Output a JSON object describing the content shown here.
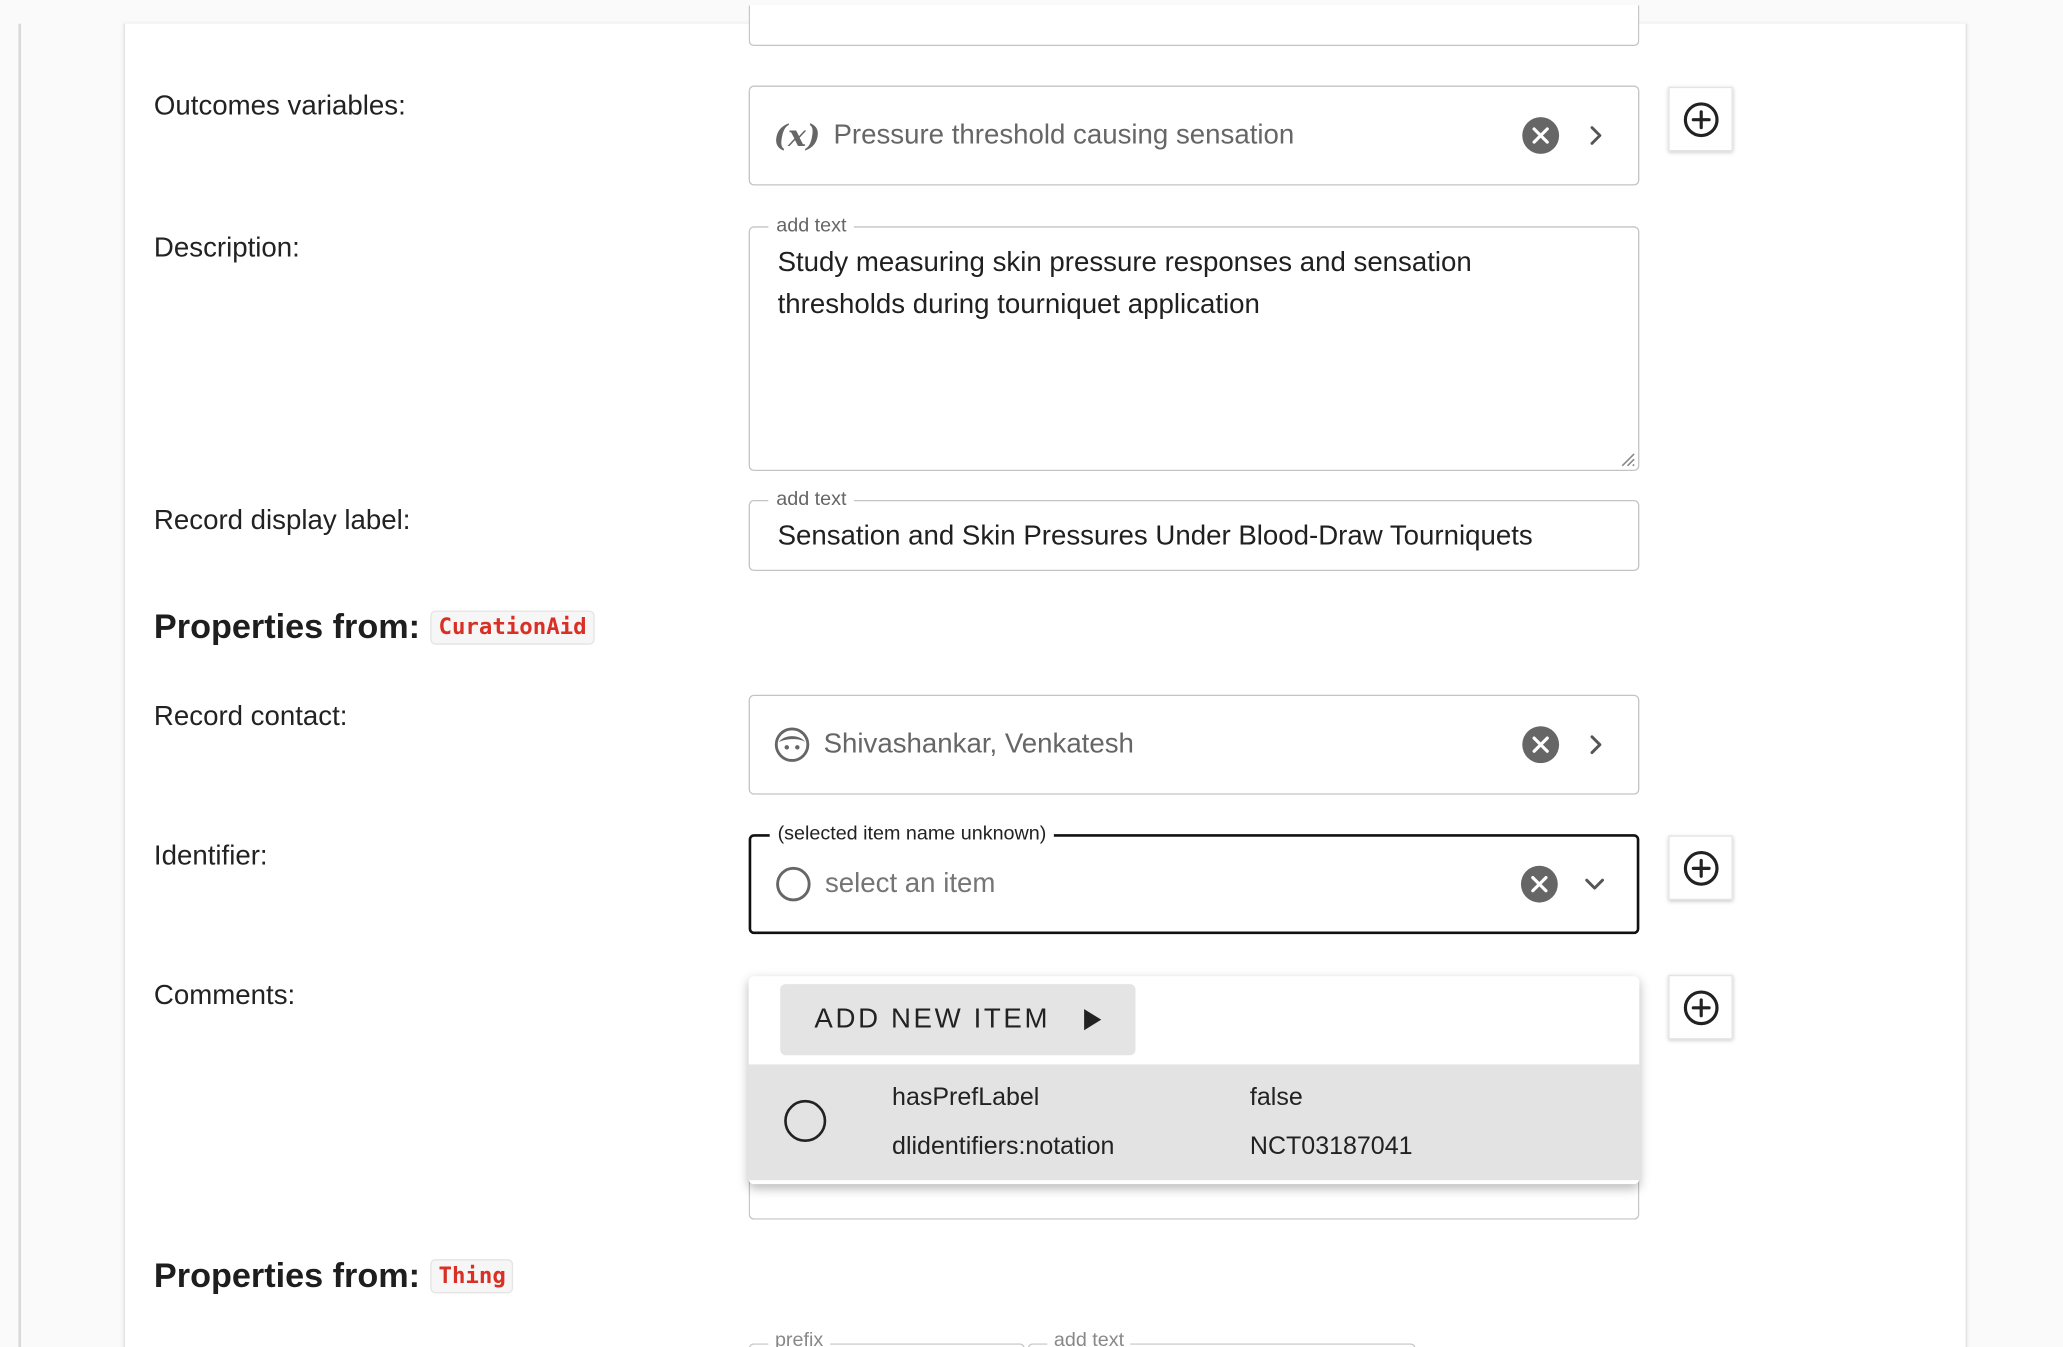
{
  "outcomes": {
    "label": "Outcomes variables:",
    "icon": "variable-icon",
    "icon_text": "(x)",
    "value": "Pressure threshold causing sensation"
  },
  "description": {
    "label": "Description:",
    "legend": "add text",
    "line1": "Study measuring skin pressure responses and sensation",
    "line2": "thresholds during tourniquet application"
  },
  "display_label": {
    "label": "Record display label:",
    "legend": "add text",
    "value": "Sensation and Skin Pressures Under Blood-Draw Tourniquets"
  },
  "section_curation": {
    "title": "Properties from:",
    "chip": "CurationAid"
  },
  "contact": {
    "label": "Record contact:",
    "icon": "person-icon",
    "value": "Shivashankar, Venkatesh"
  },
  "identifier": {
    "label": "Identifier:",
    "legend": "(selected item name unknown)",
    "placeholder": "select an item"
  },
  "comments": {
    "label": "Comments:"
  },
  "dropdown": {
    "add_new_label": "ADD NEW ITEM",
    "rows": [
      {
        "key1": "hasPrefLabel",
        "val1": "false",
        "key2": "dlidentifiers:notation",
        "val2": "NCT03187041"
      }
    ]
  },
  "section_thing": {
    "title": "Properties from:",
    "chip": "Thing"
  },
  "bottom": {
    "prefix_legend": "prefix",
    "text_legend": "add text"
  },
  "colors": {
    "chip_text": "#d93025",
    "icon_gray": "#666666",
    "focus_border": "#111111"
  }
}
